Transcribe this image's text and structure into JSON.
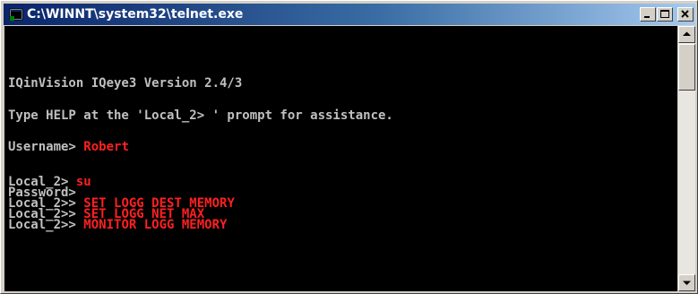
{
  "window": {
    "title": "C:\\WINNT\\system32\\telnet.exe",
    "icon": "console-app-icon"
  },
  "caption_buttons": {
    "minimize": "minimize-icon",
    "maximize": "maximize-icon",
    "close": "close-icon"
  },
  "console": {
    "banner": "IQinVision IQeye3 Version 2.4/3",
    "help_hint": "Type HELP at the 'Local_2> ' prompt for assistance.",
    "username_prompt": "Username> ",
    "username_value": "Robert",
    "local_prompt": "Local_2> ",
    "local_command": "su",
    "password_prompt": "Password>",
    "priv_prompt": "Local_2>> ",
    "commands": [
      "SET LOGG DEST MEMORY",
      "SET LOGG NET MAX",
      "MONITOR LOGG MEMORY"
    ]
  },
  "colors": {
    "console_bg": "#000000",
    "console_text": "#c0c0c0",
    "input_text": "#ff2020",
    "titlebar_start": "#0a246a",
    "titlebar_end": "#a6caf0"
  }
}
